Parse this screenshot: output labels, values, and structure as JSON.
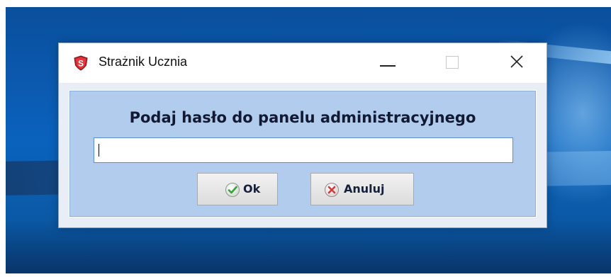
{
  "window": {
    "title": "Strażnik Ucznia",
    "app_icon": "shield-s-icon",
    "controls": [
      "minimize-icon",
      "maximize-icon",
      "close-icon"
    ]
  },
  "dialog": {
    "prompt": "Podaj hasło do panelu administracyjnego",
    "password_value": "",
    "ok_label": "Ok",
    "cancel_label": "Anuluj",
    "ok_icon": "check-circle-icon",
    "cancel_icon": "x-circle-icon"
  },
  "colors": {
    "client_bg": "#b2cced",
    "title_bg": "#ffffff",
    "field_border": "#5b8fd0"
  }
}
